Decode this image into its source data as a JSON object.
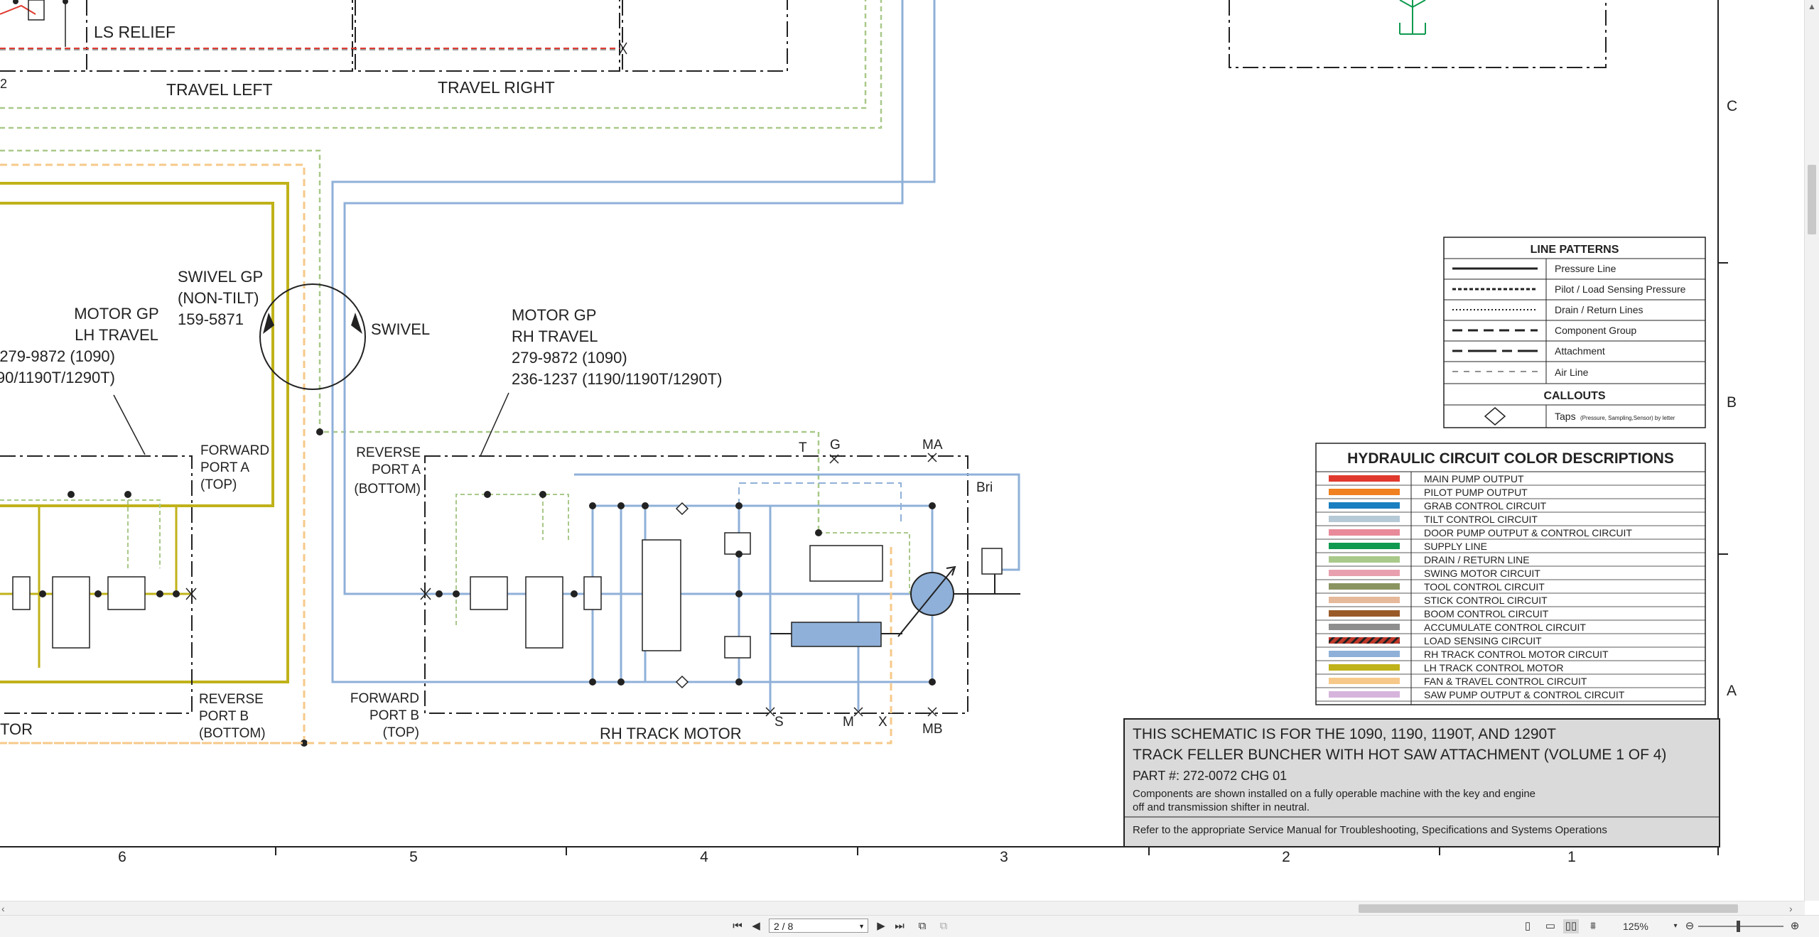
{
  "schematic": {
    "labels": {
      "ls_relief": "LS RELIEF",
      "travel_left": "TRAVEL LEFT",
      "travel_right": "TRAVEL RIGHT",
      "pin_2": "2",
      "swivel_gp": [
        "SWIVEL GP",
        "(NON-TILT)",
        "159-5871"
      ],
      "swivel": "SWIVEL",
      "motor_lh": [
        "MOTOR GP",
        "LH TRAVEL",
        "279-9872 (1090)",
        "90/1190T/1290T)"
      ],
      "motor_rh": [
        "MOTOR GP",
        "RH TRAVEL",
        "279-9872 (1090)",
        "236-1237 (1190/1190T/1290T)"
      ],
      "forward_port_a": [
        "FORWARD",
        "PORT A",
        "(TOP)"
      ],
      "reverse_port_b": [
        "REVERSE",
        "PORT B",
        "(BOTTOM)"
      ],
      "reverse_port_a": [
        "REVERSE",
        "PORT A",
        "(BOTTOM)"
      ],
      "forward_port_b": [
        "FORWARD",
        "PORT B",
        "(TOP)"
      ],
      "lh_motor_tail": "TOR",
      "rh_track_motor": "RH TRACK MOTOR",
      "port_t": "T",
      "port_g": "G",
      "port_ma": "MA",
      "port_mb": "MB",
      "port_s": "S",
      "port_m": "M",
      "port_x": "X",
      "bri": "Bri"
    },
    "zone_letters": [
      "C",
      "B",
      "A"
    ],
    "zone_numbers": [
      "6",
      "5",
      "4",
      "3",
      "2",
      "1"
    ]
  },
  "line_patterns": {
    "title": "LINE PATTERNS",
    "items": [
      "Pressure Line",
      "Pilot / Load Sensing Pressure",
      "Drain / Return Lines",
      "Component Group",
      "Attachment",
      "Air Line"
    ],
    "callouts_title": "CALLOUTS",
    "taps_label": "Taps",
    "taps_note": "(Pressure, Sampling,Sensor) by letter"
  },
  "color_legend": {
    "title": "HYDRAULIC CIRCUIT COLOR DESCRIPTIONS",
    "items": [
      {
        "label": "MAIN PUMP OUTPUT",
        "color": "#e03a2f"
      },
      {
        "label": "PILOT PUMP OUTPUT",
        "color": "#f08020"
      },
      {
        "label": "GRAB CONTROL CIRCUIT",
        "color": "#1a7fc0"
      },
      {
        "label": "TILT CONTROL CIRCUIT",
        "color": "#b5c9d6"
      },
      {
        "label": "DOOR PUMP OUTPUT & CONTROL CIRCUIT",
        "color": "#e98a9a"
      },
      {
        "label": "SUPPLY LINE",
        "color": "#0f9a4f"
      },
      {
        "label": "DRAIN / RETURN LINE",
        "color": "#a9c98a"
      },
      {
        "label": "SWING MOTOR CIRCUIT",
        "color": "#e8a0ae"
      },
      {
        "label": "TOOL CONTROL CIRCUIT",
        "color": "#8a9460"
      },
      {
        "label": "STICK CONTROL CIRCUIT",
        "color": "#e6b99a"
      },
      {
        "label": "BOOM CONTROL CIRCUIT",
        "color": "#9a5a28"
      },
      {
        "label": "ACCUMULATE CONTROL CIRCUIT",
        "color": "#8e8e8e"
      },
      {
        "label": "LOAD SENSING CIRCUIT",
        "color": "#c0392b",
        "striped": true
      },
      {
        "label": "RH TRACK CONTROL MOTOR CIRCUIT",
        "color": "#8fb0d8"
      },
      {
        "label": "LH TRACK CONTROL MOTOR",
        "color": "#c0b21a"
      },
      {
        "label": "FAN & TRAVEL CONTROL CIRCUIT",
        "color": "#f6c98a"
      },
      {
        "label": "SAW PUMP OUTPUT & CONTROL CIRCUIT",
        "color": "#d6b4dc"
      }
    ]
  },
  "title_block": {
    "line1": "THIS SCHEMATIC IS FOR THE 1090, 1190, 1190T, AND 1290T",
    "line2": "TRACK FELLER BUNCHER WITH HOT SAW ATTACHMENT (VOLUME 1 OF 4)",
    "part": "PART #: 272-0072 CHG 01",
    "note1": "Components are shown installed on a fully operable machine with the key and engine",
    "note2": "off and transmission shifter in neutral.",
    "note3": "Refer to the appropriate Service Manual for Troubleshooting, Specifications and Systems Operations"
  },
  "viewer": {
    "page_indicator": "2 / 8",
    "zoom_level": "125%",
    "colors": {
      "rh_track": "#8fb0d8",
      "lh_track": "#c0b21a",
      "fan_travel": "#f6c98a",
      "drain": "#a9c98a"
    }
  }
}
